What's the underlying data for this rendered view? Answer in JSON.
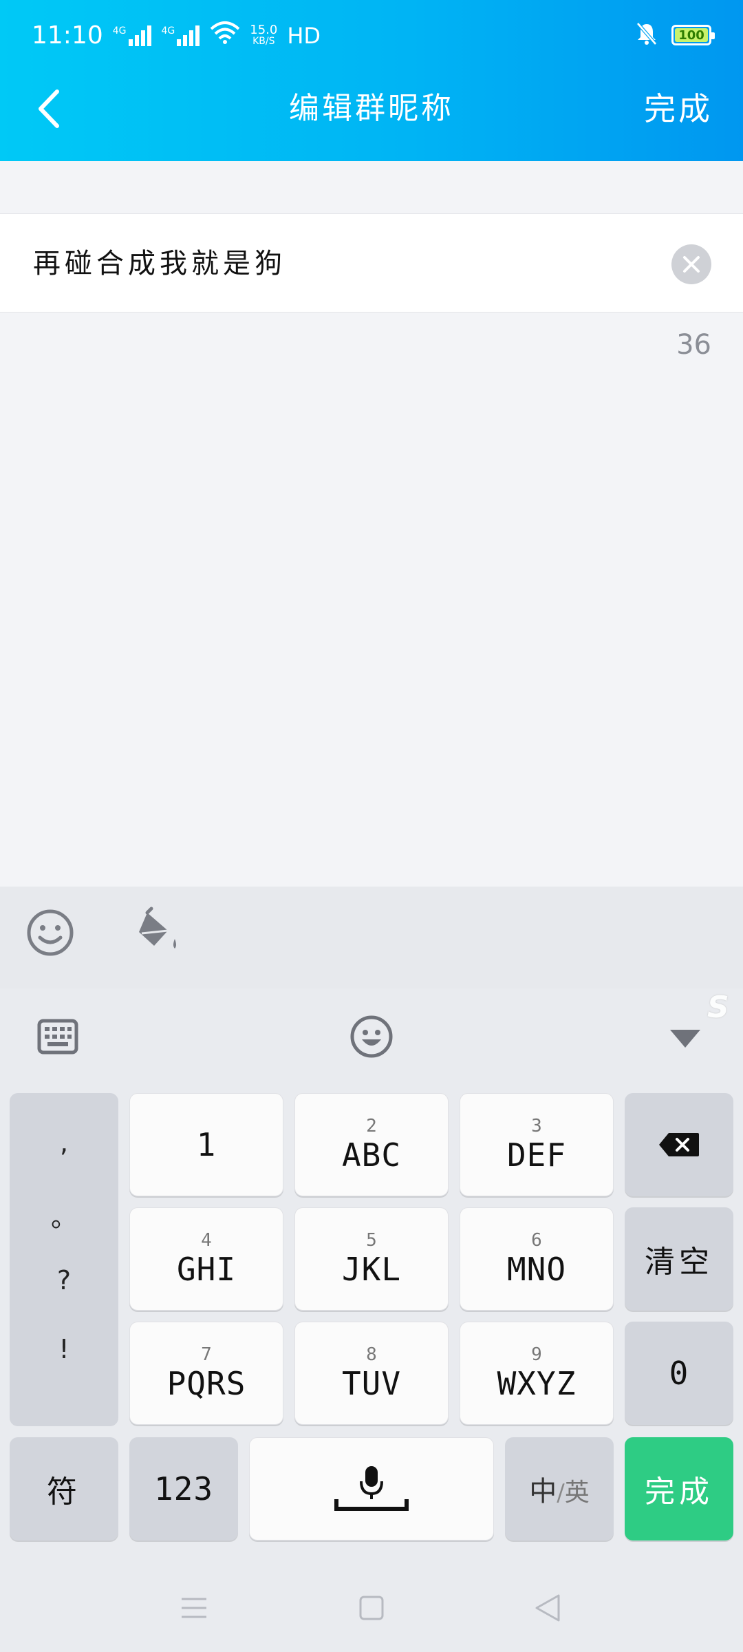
{
  "status": {
    "time": "11:10",
    "net1": "4G",
    "net2": "4G",
    "speed_top": "15.0",
    "speed_unit": "KB/S",
    "hd": "HD",
    "battery": "100"
  },
  "nav": {
    "title": "编辑群昵称",
    "done": "完成"
  },
  "input": {
    "value": "再碰合成我就是狗",
    "remaining": "36"
  },
  "keyboard": {
    "punct": [
      ",",
      "。",
      "?",
      "!"
    ],
    "rows": [
      [
        {
          "num": "",
          "main": "1"
        },
        {
          "num": "2",
          "main": "ABC"
        },
        {
          "num": "3",
          "main": "DEF"
        }
      ],
      [
        {
          "num": "4",
          "main": "GHI"
        },
        {
          "num": "5",
          "main": "JKL"
        },
        {
          "num": "6",
          "main": "MNO"
        }
      ],
      [
        {
          "num": "7",
          "main": "PQRS"
        },
        {
          "num": "8",
          "main": "TUV"
        },
        {
          "num": "9",
          "main": "WXYZ"
        }
      ]
    ],
    "clear": "清空",
    "zero": "0",
    "symbol": "符",
    "numeric": "123",
    "lang_zh": "中",
    "lang_sep": "/",
    "lang_en": "英",
    "done": "完成",
    "brand": "S"
  },
  "colors": {
    "accent": "#00b4f4",
    "done_key": "#2ecc84"
  }
}
